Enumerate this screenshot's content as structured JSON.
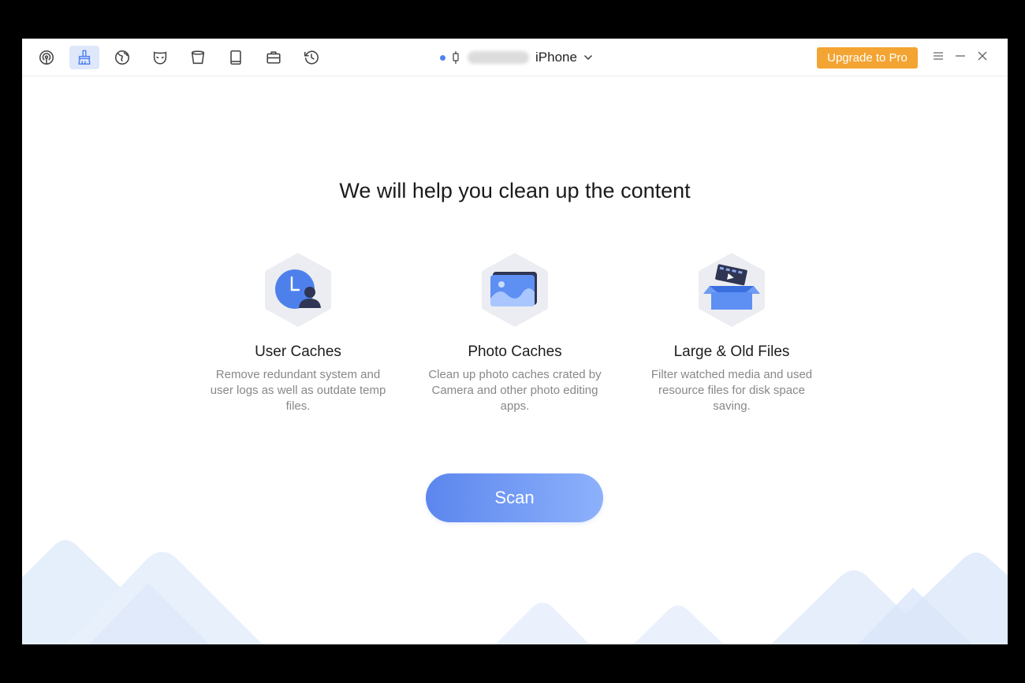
{
  "toolbar": {
    "icons": [
      "signal-icon",
      "broom-icon",
      "globe-icon",
      "mask-icon",
      "trash-bin-icon",
      "book-icon",
      "briefcase-icon",
      "history-icon"
    ],
    "active": "broom-icon"
  },
  "device": {
    "name": "iPhone",
    "status_color": "#4f83f1"
  },
  "header": {
    "upgrade_label": "Upgrade to Pro",
    "upgrade_color": "#f3a432"
  },
  "main": {
    "headline": "We will help you clean up the content",
    "features": [
      {
        "title": "User Caches",
        "description": "Remove redundant system and user logs as well as outdate temp files.",
        "icon": "user-clock-icon"
      },
      {
        "title": "Photo Caches",
        "description": "Clean up photo caches crated by Camera and other photo editing apps.",
        "icon": "photo-icon"
      },
      {
        "title": "Large & Old Files",
        "description": "Filter watched media and used resource files for disk space saving.",
        "icon": "box-files-icon"
      }
    ],
    "scan_label": "Scan"
  },
  "colors": {
    "accent": "#5c86ee",
    "accent_light": "#8db1fb"
  }
}
